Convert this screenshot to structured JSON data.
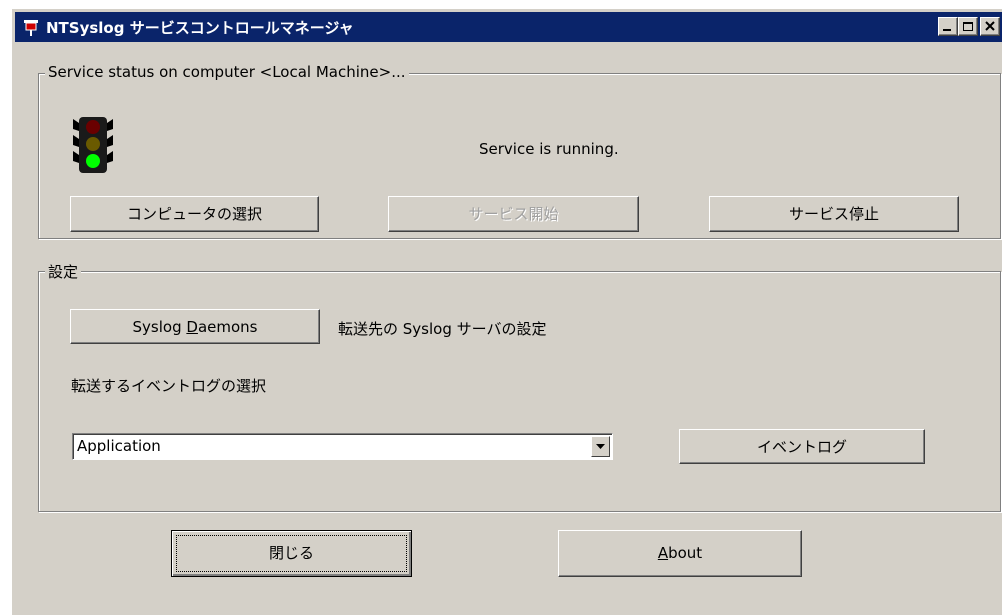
{
  "window": {
    "title": "NTSyslog サービスコントロールマネージャ"
  },
  "status_group": {
    "legend": "Service status on computer <Local Machine>...",
    "status_text": "Service is running.",
    "select_computer_label": "コンピュータの選択",
    "start_service_label": "サービス開始",
    "stop_service_label": "サービス停止"
  },
  "settings_group": {
    "legend": "設定",
    "syslog_daemons": {
      "before": "Syslog ",
      "mnemonic": "D",
      "after": "aemons"
    },
    "syslog_server_desc": "転送先の Syslog サーバの設定",
    "eventlog_select_label": "転送するイベントログの選択",
    "eventlog_selected": "Application",
    "eventlog_button_label": "イベントログ"
  },
  "footer": {
    "close_label": "閉じる",
    "about": {
      "mnemonic": "A",
      "after": "bout"
    }
  },
  "icons": {
    "app": "pin-icon",
    "traffic_light": "traffic-light-icon",
    "minimize": "minimize-icon",
    "maximize": "maximize-icon",
    "close": "close-icon",
    "dropdown": "chevron-down-icon"
  },
  "colors": {
    "titlebar": "#0a246a",
    "face": "#d4d0c8",
    "light_green": "#00ff00"
  }
}
